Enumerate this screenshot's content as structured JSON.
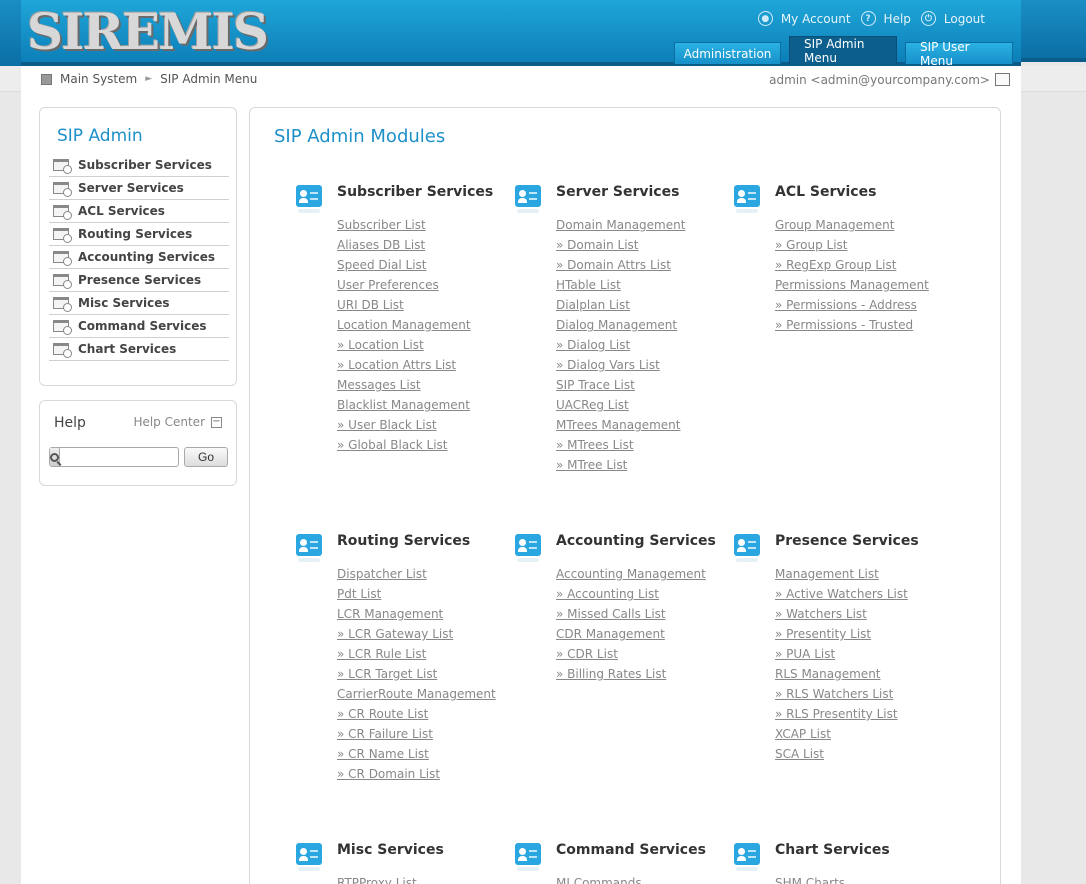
{
  "header": {
    "logo_text": "SIREMIS",
    "top_links": [
      {
        "label": "My Account",
        "icon": "user-icon"
      },
      {
        "label": "Help",
        "icon": "help-icon"
      },
      {
        "label": "Logout",
        "icon": "power-icon"
      }
    ],
    "tabs": [
      {
        "label": "Administration",
        "active": false
      },
      {
        "label": "SIP Admin Menu",
        "active": true
      },
      {
        "label": "SIP User Menu",
        "active": false
      }
    ]
  },
  "breadcrumb": {
    "items": [
      "Main System",
      "SIP Admin Menu"
    ],
    "user": "admin <admin@yourcompany.com>"
  },
  "sidebar": {
    "title": "SIP Admin",
    "items": [
      {
        "label": "Subscriber Services"
      },
      {
        "label": "Server Services"
      },
      {
        "label": "ACL Services"
      },
      {
        "label": "Routing Services"
      },
      {
        "label": "Accounting Services"
      },
      {
        "label": "Presence Services"
      },
      {
        "label": "Misc Services"
      },
      {
        "label": "Command Services"
      },
      {
        "label": "Chart Services"
      }
    ]
  },
  "help": {
    "title": "Help",
    "center_label": "Help Center",
    "search_value": "",
    "go_label": "Go"
  },
  "main": {
    "title": "SIP Admin Modules",
    "modules": [
      {
        "title": "Subscriber Services",
        "links": [
          "Subscriber List",
          "Aliases DB List",
          "Speed Dial List",
          "User Preferences",
          "URI DB List",
          "Location Management",
          "» Location List",
          "» Location Attrs List",
          "Messages List",
          "Blacklist Management",
          "» User Black List",
          "» Global Black List"
        ]
      },
      {
        "title": "Server Services",
        "links": [
          "Domain Management",
          "» Domain List",
          "» Domain Attrs List",
          "HTable List",
          "Dialplan List",
          "Dialog Management",
          "» Dialog List",
          "» Dialog Vars List",
          "SIP Trace List",
          "UACReg List",
          "MTrees Management",
          "» MTrees List",
          "» MTree List"
        ]
      },
      {
        "title": "ACL Services",
        "links": [
          "Group Management",
          "» Group List",
          "» RegExp Group List",
          "Permissions Management",
          "» Permissions - Address",
          "» Permissions - Trusted"
        ]
      },
      {
        "title": "Routing Services",
        "links": [
          "Dispatcher List",
          "Pdt List",
          "LCR Management",
          "» LCR Gateway List",
          "» LCR Rule List",
          "» LCR Target List",
          "CarrierRoute Management",
          "» CR Route List",
          "» CR Failure List",
          "» CR Name List",
          "» CR Domain List"
        ]
      },
      {
        "title": "Accounting Services",
        "links": [
          "Accounting Management",
          "» Accounting List",
          "» Missed Calls List",
          "CDR Management",
          "» CDR List",
          "» Billing Rates List"
        ]
      },
      {
        "title": "Presence Services",
        "links": [
          "Management List",
          "» Active Watchers List",
          "» Watchers List",
          "» Presentity List",
          "» PUA List",
          "RLS Management",
          "» RLS Watchers List",
          "» RLS Presentity List",
          "XCAP List",
          "SCA List"
        ]
      },
      {
        "title": "Misc Services",
        "links": [
          "RTPProxy List"
        ]
      },
      {
        "title": "Command Services",
        "links": [
          "MI Commands"
        ]
      },
      {
        "title": "Chart Services",
        "links": [
          "SHM Charts"
        ]
      }
    ]
  }
}
